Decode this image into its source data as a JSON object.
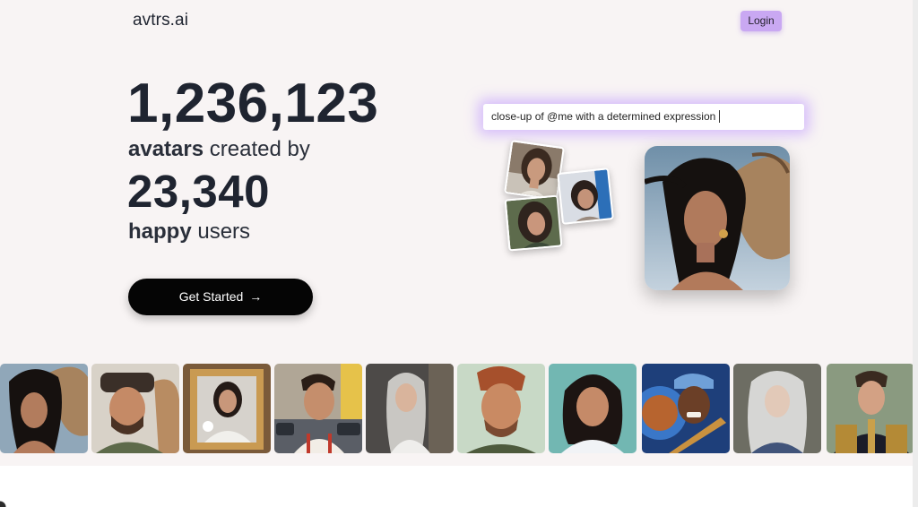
{
  "header": {
    "logo": "avtrs.ai",
    "login_label": "Login"
  },
  "hero": {
    "avatars_count": "1,236,123",
    "avatars_word": "avatars",
    "created_by": "created by",
    "users_count": "23,340",
    "happy_word": "happy",
    "users_word": "users",
    "cta_label": "Get Started",
    "cta_icon": "arrow-right-icon",
    "cta_arrow": "→"
  },
  "prompt": {
    "text": "close-up of @me with a determined expression"
  },
  "colors": {
    "accent": "#c9a8f2",
    "background": "#f8f4f4",
    "cta": "#050505",
    "text": "#1f2430"
  },
  "gallery": {
    "items": [
      "avatar-woman-with-camel",
      "avatar-bearded-man-with-camel",
      "avatar-woman-in-gold-frame",
      "avatar-man-in-city-street",
      "avatar-silver-haired-woman-in-blazer",
      "avatar-cartoon-man-with-quiff",
      "avatar-cartoon-girl-in-hoodie",
      "avatar-man-with-blue-cap-and-globe",
      "avatar-white-haired-woman",
      "avatar-man-in-military-uniform"
    ]
  }
}
